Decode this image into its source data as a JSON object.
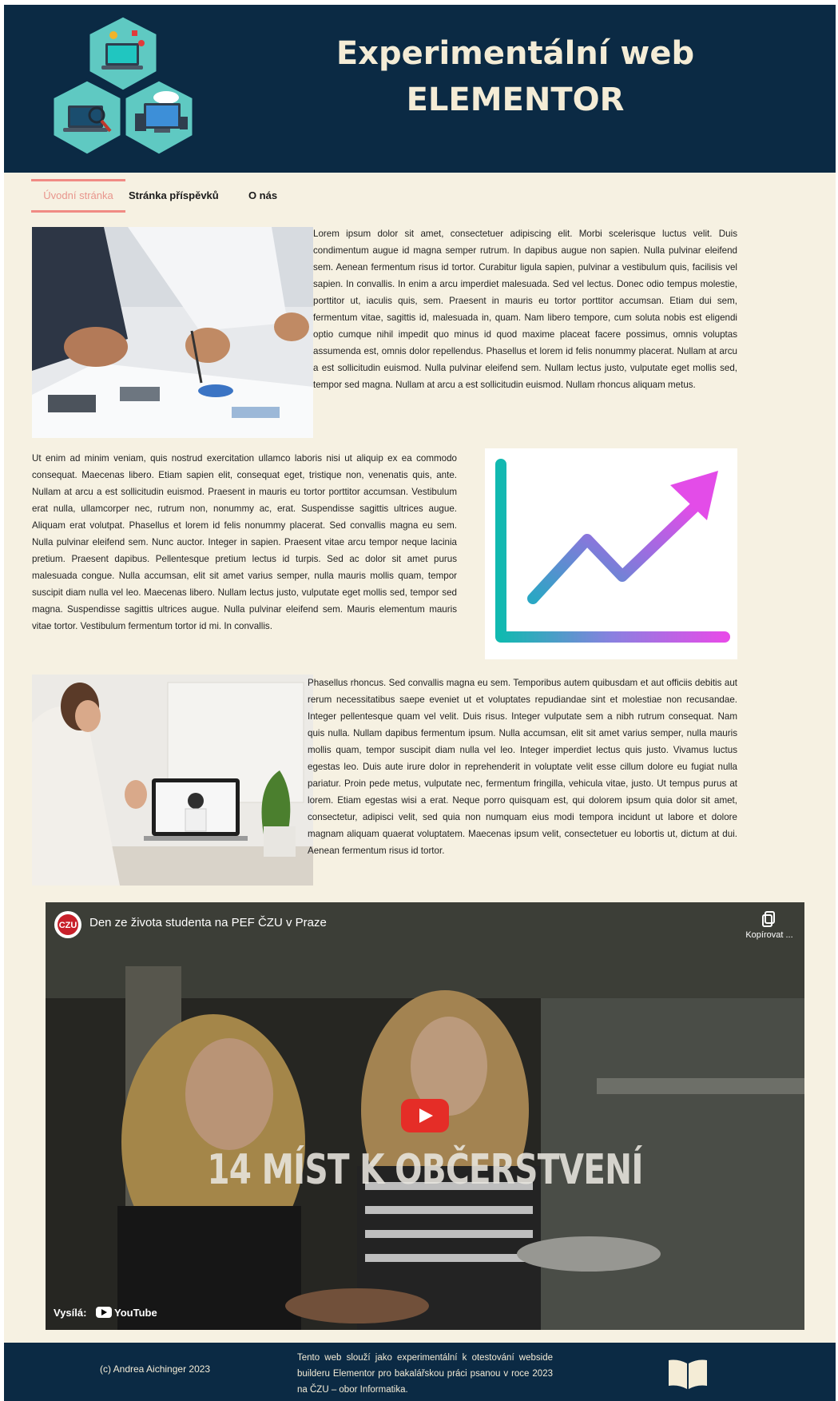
{
  "header": {
    "title_line1": "Experimentální web",
    "title_line2": "ELEMENTOR",
    "logo_icon": "hexagon-computers-logo"
  },
  "nav": {
    "items": [
      {
        "label": "Úvodní stránka",
        "active": true
      },
      {
        "label": "Stránka příspěvků",
        "active": false
      },
      {
        "label": "O nás",
        "active": false
      }
    ]
  },
  "sections": {
    "s1_text": "Lorem ipsum dolor sit amet, consectetuer adipiscing elit. Morbi scelerisque luctus velit. Duis condimentum augue id magna semper rutrum. In dapibus augue non sapien. Nulla pulvinar eleifend sem. Aenean fermentum risus id tortor. Curabitur ligula sapien, pulvinar a vestibulum quis, facilisis vel sapien. In convallis. In enim a arcu imperdiet malesuada. Sed vel lectus. Donec odio tempus molestie, porttitor ut, iaculis quis, sem. Praesent in mauris eu tortor porttitor accumsan. Etiam dui sem, fermentum vitae, sagittis id, malesuada in, quam. Nam libero tempore, cum soluta nobis est eligendi optio cumque nihil impedit quo minus id quod maxime placeat facere possimus, omnis voluptas assumenda est, omnis dolor repellendus. Phasellus et lorem id felis nonummy placerat. Nullam at arcu a est sollicitudin euismod. Nulla pulvinar eleifend sem. Nullam lectus justo, vulputate eget mollis sed, tempor sed magna. Nullam at arcu a est sollicitudin euismod. Nullam rhoncus aliquam metus.",
    "s2_text": "Ut enim ad minim veniam, quis nostrud exercitation ullamco laboris nisi ut aliquip ex ea commodo consequat. Maecenas libero. Etiam sapien elit, consequat eget, tristique non, venenatis quis, ante. Nullam at arcu a est sollicitudin euismod. Praesent in mauris eu tortor porttitor accumsan. Vestibulum erat nulla, ullamcorper nec, rutrum non, nonummy ac, erat. Suspendisse sagittis ultrices augue. Aliquam erat volutpat. Phasellus et lorem id felis nonummy placerat. Sed convallis magna eu sem. Nulla pulvinar eleifend sem. Nunc auctor. Integer in sapien. Praesent vitae arcu tempor neque lacinia pretium. Praesent dapibus. Pellentesque pretium lectus id turpis. Sed ac dolor sit amet purus malesuada congue. Nulla accumsan, elit sit amet varius semper, nulla mauris mollis quam, tempor suscipit diam nulla vel leo. Maecenas libero. Nullam lectus justo, vulputate eget mollis sed, tempor sed magna. Suspendisse sagittis ultrices augue. Nulla pulvinar eleifend sem. Mauris elementum mauris vitae tortor. Vestibulum fermentum tortor id mi. In convallis.",
    "s3_text": "Phasellus rhoncus. Sed convallis magna eu sem. Temporibus autem quibusdam et aut officiis debitis aut rerum necessitatibus saepe eveniet ut et voluptates repudiandae sint et molestiae non recusandae. Integer pellentesque quam vel velit. Duis risus. Integer vulputate sem a nibh rutrum consequat. Nam quis nulla. Nullam dapibus fermentum ipsum. Nulla accumsan, elit sit amet varius semper, nulla mauris mollis quam, tempor suscipit diam nulla vel leo. Integer imperdiet lectus quis justo. Vivamus luctus egestas leo. Duis aute irure dolor in reprehenderit in voluptate velit esse cillum dolore eu fugiat nulla pariatur. Proin pede metus, vulputate nec, fermentum fringilla, vehicula vitae, justo. Ut tempus purus at lorem. Etiam egestas wisi a erat. Neque porro quisquam est, qui dolorem ipsum quia dolor sit amet, consectetur, adipisci velit, sed quia non numquam eius modi tempora incidunt ut labore et dolore magnam aliquam quaerat voluptatem. Maecenas ipsum velit, consectetuer eu lobortis ut, dictum at dui. Aenean fermentum risus id tortor."
  },
  "video": {
    "title": "Den ze života studenta na PEF ČZU v Praze",
    "channel_logo": "CZU",
    "copy_label": "Kopírovat ...",
    "overlay_text": "14 MÍST K OBČERSTVENÍ",
    "watch_on_label": "Vysílá:",
    "platform": "YouTube"
  },
  "footer": {
    "copyright": "(c) Andrea Aichinger 2023",
    "description": "Tento web slouží jako experimentální k otestování webside builderu Elementor pro bakalářskou práci psanou v roce 2023 na ČZU – obor Informatika.",
    "icon": "open-book-icon"
  },
  "colors": {
    "header_bg": "#0b2a44",
    "page_bg": "#f6f1e2",
    "accent": "#f08b84",
    "play_red": "#e52d27"
  }
}
